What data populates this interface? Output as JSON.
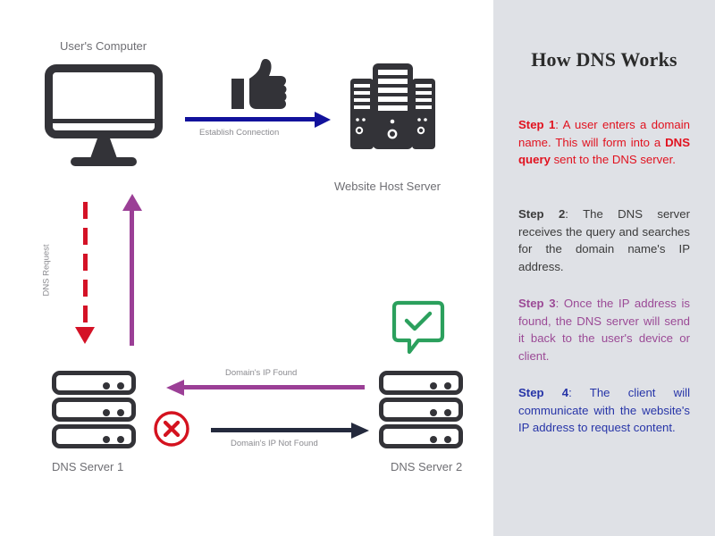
{
  "sidebar": {
    "title": "How DNS Works",
    "steps": [
      {
        "id": "step1",
        "label": "Step 1",
        "color": "#e1121f",
        "text_before": ": A user enters a domain name. This will form into a ",
        "emphasis": "DNS query",
        "text_after": " sent to the DNS server."
      },
      {
        "id": "step2",
        "label": "Step 2",
        "color": "#3b3b3b",
        "text": ": The DNS server receives the query and searches for the domain name's IP address."
      },
      {
        "id": "step3",
        "label": "Step 3",
        "color": "#9b4a96",
        "text": ": Once the IP address is found, the DNS server will send it back to the user's device or client."
      },
      {
        "id": "step4",
        "label": "Step 4",
        "color": "#2735a8",
        "text": ": The client will communicate with the website's IP address to request content."
      }
    ]
  },
  "diagram": {
    "nodes": {
      "user_computer": {
        "caption": "User's Computer",
        "icon": "monitor-icon"
      },
      "host_server": {
        "caption": "Website Host Server",
        "icon": "server-tower-icon"
      },
      "dns_server_1": {
        "caption": "DNS Server 1",
        "icon": "server-rack-icon"
      },
      "dns_server_2": {
        "caption": "DNS Server 2",
        "icon": "server-rack-icon"
      }
    },
    "arrows": {
      "establish_connection": {
        "label": "Establish Connection",
        "color": "#12129c",
        "direction": "right",
        "style": "solid"
      },
      "dns_request": {
        "label": "DNS Request",
        "color": "#d41226",
        "direction": "down",
        "style": "dashed"
      },
      "dns_response": {
        "label": "",
        "color": "#9b3f96",
        "direction": "up",
        "style": "solid"
      },
      "domain_ip_found": {
        "label": "Domain's IP Found",
        "color": "#9b3f96",
        "direction": "left",
        "style": "solid"
      },
      "domain_ip_not_found": {
        "label": "Domain's IP Not Found",
        "color": "#242a3d",
        "direction": "right",
        "style": "solid"
      }
    },
    "status_icons": {
      "thumbs_up": {
        "name": "thumbs-up-icon",
        "color": "#333338"
      },
      "failure": {
        "name": "x-circle-icon",
        "color": "#d4121f"
      },
      "success": {
        "name": "check-bubble-icon",
        "color": "#2ba05d"
      }
    }
  },
  "colors": {
    "panel_background": "#dfe1e6",
    "canvas_background": "#ffffff",
    "icon_dark": "#333338",
    "caption_gray": "#6e6e73",
    "label_gray": "#8a8a8f"
  }
}
